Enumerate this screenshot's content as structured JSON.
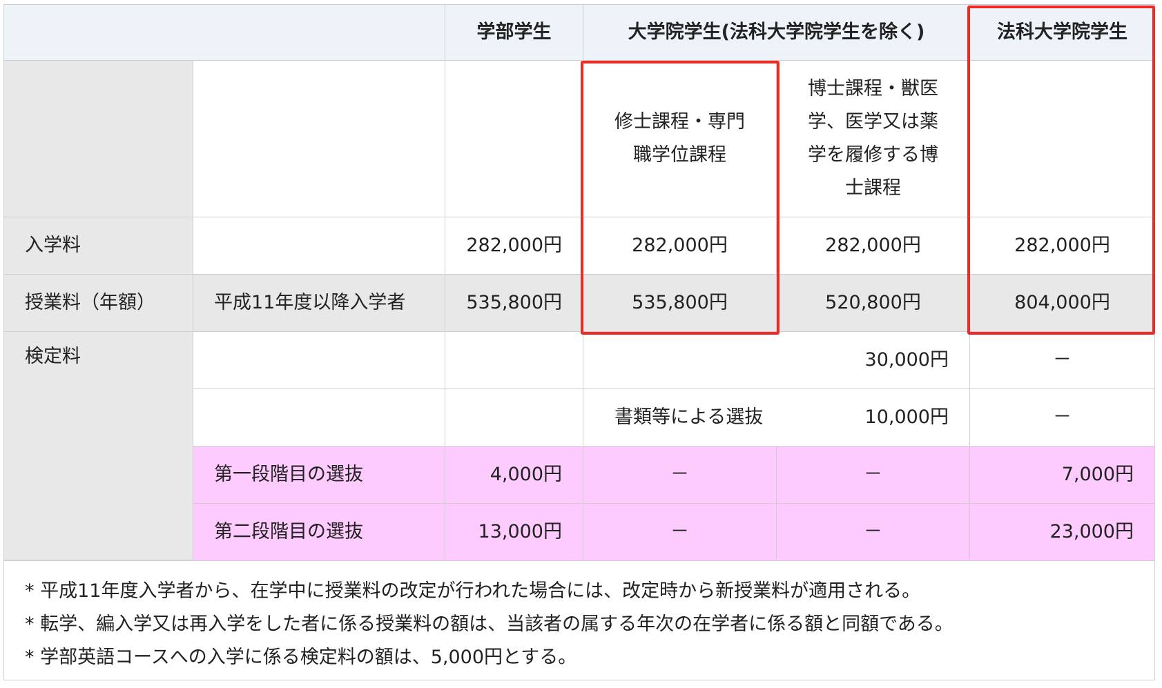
{
  "headers": {
    "blank": "",
    "undergraduate": "学部学生",
    "graduate": "大学院学生(法科大学院学生を除く)",
    "law_school": "法科大学院学生"
  },
  "subheaders": {
    "masters": [
      "修士課程・専門",
      "職学位課程"
    ],
    "doctoral": [
      "博士課程・獣医",
      "学、医学又は薬",
      "学を履修する博",
      "士課程"
    ]
  },
  "rows": {
    "admission": {
      "label": "入学料",
      "undergraduate": "282,000円",
      "masters": "282,000円",
      "doctoral": "282,000円",
      "law": "282,000円"
    },
    "tuition": {
      "label": "授業料（年額）",
      "sublabel": "平成11年度以降入学者",
      "undergraduate": "535,800円",
      "masters": "535,800円",
      "doctoral": "520,800円",
      "law": "804,000円"
    },
    "exam": {
      "label": "検定料",
      "row1_graduate": "30,000円",
      "row1_law": "－",
      "row2_graduate_label": "書類等による選抜",
      "row2_graduate": "10,000円",
      "row2_law": "－",
      "stage1": {
        "label": "第一段階目の選抜",
        "undergraduate": "4,000円",
        "masters": "－",
        "doctoral": "－",
        "law": "7,000円"
      },
      "stage2": {
        "label": "第二段階目の選抜",
        "undergraduate": "13,000円",
        "masters": "－",
        "doctoral": "－",
        "law": "23,000円"
      }
    }
  },
  "notes": [
    "* 平成11年度入学者から、在学中に授業料の改定が行われた場合には、改定時から新授業料が適用される。",
    "* 転学、編入学又は再入学をした者に係る授業料の額は、当該者の属する年次の在学者に係る額と同額である。",
    "* 学部英語コースへの入学に係る検定料の額は、5,000円とする。"
  ],
  "colors": {
    "highlight": "#ec2b27",
    "header_bg": "#eef3fa",
    "gray_bg": "#e8e8e8",
    "pink_bg": "#fdcbfd"
  }
}
